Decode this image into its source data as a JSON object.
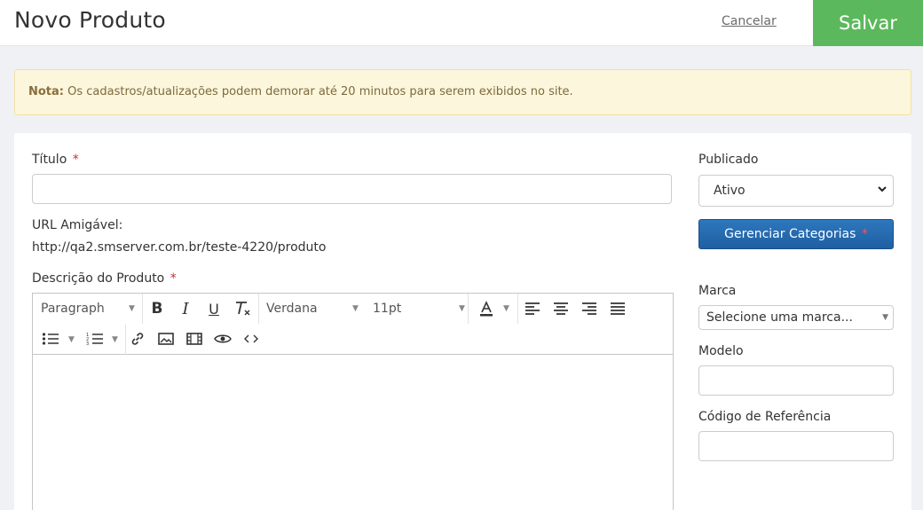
{
  "header": {
    "title": "Novo Produto",
    "cancel_label": "Cancelar",
    "save_label": "Salvar"
  },
  "note": {
    "prefix": "Nota:",
    "text": "Os cadastros/atualizações podem demorar até 20 minutos para serem exibidos no site."
  },
  "form": {
    "titulo_label": "Título",
    "required_mark": "*",
    "titulo_value": "",
    "url_label": "URL Amigável:",
    "url_value": "http://qa2.smserver.com.br/teste-4220/produto",
    "descricao_label": "Descrição do Produto",
    "editor": {
      "format_select": "Paragraph",
      "font_select": "Verdana",
      "size_select": "11pt"
    },
    "publicado_label": "Publicado",
    "publicado_value": "Ativo",
    "categorias_label": "Gerenciar Categorias",
    "marca_label": "Marca",
    "marca_value": "Selecione uma marca...",
    "modelo_label": "Modelo",
    "modelo_value": "",
    "codigo_label": "Código de Referência",
    "codigo_value": ""
  },
  "colors": {
    "save": "#5cb85c",
    "note_bg": "#fcf6dd",
    "primary": "#2a6db2",
    "required": "#c9302c"
  },
  "icons": [
    "bold-icon",
    "italic-icon",
    "underline-icon",
    "clear-format-icon",
    "font-color-icon",
    "align-left-icon",
    "align-center-icon",
    "align-right-icon",
    "align-justify-icon",
    "bullet-list-icon",
    "numbered-list-icon",
    "link-icon",
    "image-icon",
    "video-icon",
    "preview-icon",
    "code-icon"
  ]
}
